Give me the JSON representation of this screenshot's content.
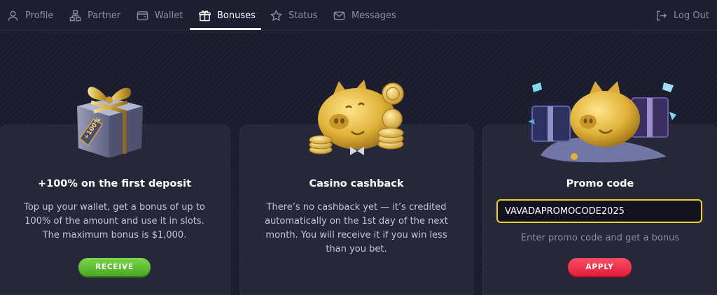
{
  "nav": {
    "items": [
      {
        "label": "Profile",
        "icon": "user-icon"
      },
      {
        "label": "Partner",
        "icon": "partner-icon"
      },
      {
        "label": "Wallet",
        "icon": "wallet-icon"
      },
      {
        "label": "Bonuses",
        "icon": "gift-icon",
        "active": true
      },
      {
        "label": "Status",
        "icon": "star-icon"
      },
      {
        "label": "Messages",
        "icon": "mail-icon"
      }
    ],
    "logout_label": "Log Out"
  },
  "cards": {
    "deposit": {
      "title": "+100% on the first deposit",
      "description": "Top up your wallet, get a bonus of up to 100% of the amount and use it in slots. The maximum bonus is $1,000.",
      "button_label": "RECEIVE",
      "tag_text": "+100%"
    },
    "cashback": {
      "title": "Casino cashback",
      "description": "There’s no cashback yet — it’s credited automatically on the 1st day of the next month. You will receive it if you win less than you bet."
    },
    "promo": {
      "title": "Promo code",
      "input_value": "VAVADAPROMOCODE2025",
      "hint": "Enter promo code and get a bonus",
      "button_label": "APPLY"
    }
  },
  "colors": {
    "background": "#1b1c2e",
    "card": "#262739",
    "accent_yellow": "#f3cf2a",
    "button_green": "#5cbf30",
    "button_red": "#f03a52"
  }
}
